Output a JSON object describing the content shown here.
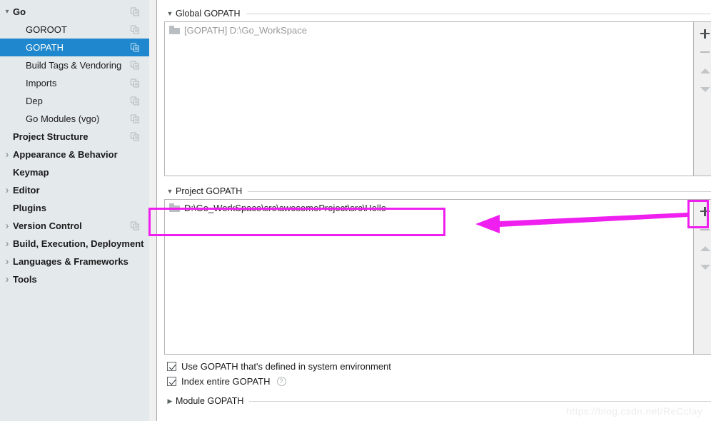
{
  "sidebar": {
    "items": [
      {
        "label": "Go",
        "level": 0,
        "bold": true,
        "expander": "down",
        "selected": false,
        "copy_icon": true
      },
      {
        "label": "GOROOT",
        "level": 1,
        "bold": false,
        "expander": "none",
        "selected": false,
        "copy_icon": true
      },
      {
        "label": "GOPATH",
        "level": 1,
        "bold": false,
        "expander": "none",
        "selected": true,
        "copy_icon": true
      },
      {
        "label": "Build Tags & Vendoring",
        "level": 1,
        "bold": false,
        "expander": "none",
        "selected": false,
        "copy_icon": true
      },
      {
        "label": "Imports",
        "level": 1,
        "bold": false,
        "expander": "none",
        "selected": false,
        "copy_icon": true
      },
      {
        "label": "Dep",
        "level": 1,
        "bold": false,
        "expander": "none",
        "selected": false,
        "copy_icon": true
      },
      {
        "label": "Go Modules (vgo)",
        "level": 1,
        "bold": false,
        "expander": "none",
        "selected": false,
        "copy_icon": true
      },
      {
        "label": "Project Structure",
        "level": 0,
        "bold": true,
        "expander": "none",
        "selected": false,
        "copy_icon": true
      },
      {
        "label": "Appearance & Behavior",
        "level": 0,
        "bold": true,
        "expander": "right",
        "selected": false,
        "copy_icon": false
      },
      {
        "label": "Keymap",
        "level": 0,
        "bold": true,
        "expander": "none",
        "selected": false,
        "copy_icon": false
      },
      {
        "label": "Editor",
        "level": 0,
        "bold": true,
        "expander": "right",
        "selected": false,
        "copy_icon": false
      },
      {
        "label": "Plugins",
        "level": 0,
        "bold": true,
        "expander": "none",
        "selected": false,
        "copy_icon": false
      },
      {
        "label": "Version Control",
        "level": 0,
        "bold": true,
        "expander": "right",
        "selected": false,
        "copy_icon": true
      },
      {
        "label": "Build, Execution, Deployment",
        "level": 0,
        "bold": true,
        "expander": "right",
        "selected": false,
        "copy_icon": false
      },
      {
        "label": "Languages & Frameworks",
        "level": 0,
        "bold": true,
        "expander": "right",
        "selected": false,
        "copy_icon": false
      },
      {
        "label": "Tools",
        "level": 0,
        "bold": true,
        "expander": "right",
        "selected": false,
        "copy_icon": false
      }
    ]
  },
  "global_gopath": {
    "title": "Global GOPATH",
    "expanded": true,
    "entries": [
      {
        "text": "[GOPATH] D:\\Go_WorkSpace",
        "muted": true
      }
    ],
    "toolbar": {
      "add_label": "+",
      "remove_label": "−",
      "move_up_label": "Move Up",
      "move_down_label": "Move Down"
    }
  },
  "project_gopath": {
    "title": "Project GOPATH",
    "expanded": true,
    "entries": [
      {
        "text": "D:\\Go_WorkSpace\\src\\awesomeProject\\src\\Hello",
        "muted": false
      }
    ],
    "toolbar": {
      "add_label": "+",
      "remove_label": "−",
      "move_up_label": "Move Up",
      "move_down_label": "Move Down"
    }
  },
  "options": [
    {
      "label": "Use GOPATH that's defined in system environment",
      "checked": true,
      "help": false
    },
    {
      "label": "Index entire GOPATH",
      "checked": true,
      "help": true,
      "help_glyph": "?"
    }
  ],
  "module_gopath": {
    "title": "Module GOPATH",
    "expanded": false
  },
  "annotations": {
    "highlight_color": "#ef20ef",
    "arrow_note": "points from add button to project gopath entry"
  },
  "watermark": {
    "text": "https://blog.csdn.net/ReCclay"
  }
}
